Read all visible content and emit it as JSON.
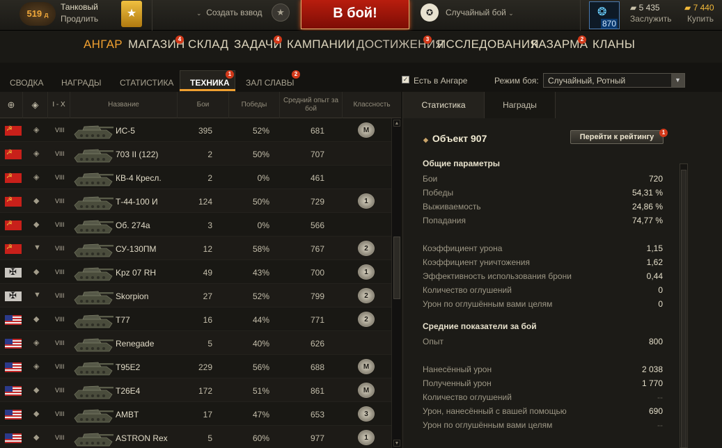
{
  "topbar": {
    "premium_days": "519",
    "premium_days_unit": "д",
    "premium_title": "Танковый",
    "premium_extend": "Продлить",
    "create_platoon": "Создать взвод",
    "battle_button": "В бой!",
    "battle_mode": "Случайный бой",
    "gold_box_count": "870",
    "credits": "5 435",
    "earn_label": "Заслужить",
    "gold": "7 440",
    "buy_label": "Купить"
  },
  "main_nav": [
    {
      "label": "АНГАР",
      "badge": ""
    },
    {
      "label": "МАГАЗИН",
      "badge": "4"
    },
    {
      "label": "СКЛАД",
      "badge": ""
    },
    {
      "label": "ЗАДАЧИ",
      "badge": "4"
    },
    {
      "label": "КАМПАНИИ",
      "badge": ""
    },
    {
      "label": "ДОСТИЖЕНИЯ",
      "badge": "3"
    },
    {
      "label": "ИССЛЕДОВАНИЯ",
      "badge": ""
    },
    {
      "label": "КАЗАРМА",
      "badge": "2"
    },
    {
      "label": "КЛАНЫ",
      "badge": ""
    }
  ],
  "sub_tabs": [
    {
      "label": "СВОДКА",
      "badge": ""
    },
    {
      "label": "НАГРАДЫ",
      "badge": ""
    },
    {
      "label": "СТАТИСТИКА",
      "badge": ""
    },
    {
      "label": "ТЕХНИКА",
      "badge": "1"
    },
    {
      "label": "ЗАЛ СЛАВЫ",
      "badge": "2"
    }
  ],
  "filters": {
    "in_hangar_label": "Есть в Ангаре",
    "in_hangar_checked": true,
    "battle_mode_label": "Режим боя:",
    "battle_mode_value": "Случайный, Ротный"
  },
  "table": {
    "headers": {
      "nation": "globe-icon",
      "type": "vehicle-type-icon",
      "tier": "I - X",
      "name": "Название",
      "battles": "Бои",
      "wins": "Победы",
      "avg_exp": "Средний опыт за бой",
      "mastery": "Классность"
    },
    "rows": [
      {
        "nation": "ussr",
        "type": "◈",
        "tier": "VIII",
        "name": "ИС-5",
        "battles": "395",
        "wins": "52%",
        "exp": "681",
        "mastery": "M"
      },
      {
        "nation": "ussr",
        "type": "◈",
        "tier": "VIII",
        "name": "703 II (122)",
        "battles": "2",
        "wins": "50%",
        "exp": "707",
        "mastery": ""
      },
      {
        "nation": "ussr",
        "type": "◈",
        "tier": "VIII",
        "name": "КВ-4 Кресл.",
        "battles": "2",
        "wins": "0%",
        "exp": "461",
        "mastery": ""
      },
      {
        "nation": "ussr",
        "type": "◆",
        "tier": "VIII",
        "name": "Т-44-100 И",
        "battles": "124",
        "wins": "50%",
        "exp": "729",
        "mastery": "1"
      },
      {
        "nation": "ussr",
        "type": "◆",
        "tier": "VIII",
        "name": "Об. 274а",
        "battles": "3",
        "wins": "0%",
        "exp": "566",
        "mastery": ""
      },
      {
        "nation": "ussr",
        "type": "▼",
        "tier": "VIII",
        "name": "СУ-130ПМ",
        "battles": "12",
        "wins": "58%",
        "exp": "767",
        "mastery": "2"
      },
      {
        "nation": "ger",
        "type": "◆",
        "tier": "VIII",
        "name": "Kpz 07 RH",
        "battles": "49",
        "wins": "43%",
        "exp": "700",
        "mastery": "1"
      },
      {
        "nation": "ger",
        "type": "▼",
        "tier": "VIII",
        "name": "Skorpion",
        "battles": "27",
        "wins": "52%",
        "exp": "799",
        "mastery": "2"
      },
      {
        "nation": "usa",
        "type": "◆",
        "tier": "VIII",
        "name": "T77",
        "battles": "16",
        "wins": "44%",
        "exp": "771",
        "mastery": "2"
      },
      {
        "nation": "usa",
        "type": "◈",
        "tier": "VIII",
        "name": "Renegade",
        "battles": "5",
        "wins": "40%",
        "exp": "626",
        "mastery": ""
      },
      {
        "nation": "usa",
        "type": "◈",
        "tier": "VIII",
        "name": "T95E2",
        "battles": "229",
        "wins": "56%",
        "exp": "688",
        "mastery": "M"
      },
      {
        "nation": "usa",
        "type": "◆",
        "tier": "VIII",
        "name": "T26E4",
        "battles": "172",
        "wins": "51%",
        "exp": "861",
        "mastery": "M"
      },
      {
        "nation": "usa",
        "type": "◆",
        "tier": "VIII",
        "name": "AMBT",
        "battles": "17",
        "wins": "47%",
        "exp": "653",
        "mastery": "3"
      },
      {
        "nation": "usa",
        "type": "◆",
        "tier": "VIII",
        "name": "ASTRON Rex",
        "battles": "5",
        "wins": "60%",
        "exp": "977",
        "mastery": "1"
      }
    ]
  },
  "details": {
    "tabs": [
      "Статистика",
      "Награды"
    ],
    "vehicle_name": "Объект 907",
    "rating_button": "Перейти к рейтингу",
    "rating_badge": "1",
    "general_title": "Общие параметры",
    "general": [
      {
        "label": "Бои",
        "value": "720"
      },
      {
        "label": "Победы",
        "value": "54,31 %"
      },
      {
        "label": "Выживаемость",
        "value": "24,86 %"
      },
      {
        "label": "Попадания",
        "value": "74,77 %"
      },
      {
        "label": "Коэффициент урона",
        "value": "1,15"
      },
      {
        "label": "Коэффициент уничтожения",
        "value": "1,62"
      },
      {
        "label": "Эффективность использования брони",
        "value": "0,44"
      },
      {
        "label": "Количество оглушений",
        "value": "0"
      },
      {
        "label": "Урон по оглушённым вами целям",
        "value": "0"
      }
    ],
    "avg_title": "Средние показатели за бой",
    "avg": [
      {
        "label": "Опыт",
        "value": "800"
      },
      {
        "label": "Нанесённый урон",
        "value": "2 038"
      },
      {
        "label": "Полученный урон",
        "value": "1 770"
      },
      {
        "label": "Количество оглушений",
        "value": "--"
      },
      {
        "label": "Урон, нанесённый с вашей помощью",
        "value": "690"
      },
      {
        "label": "Урон по оглушённым вами целям",
        "value": "--"
      }
    ]
  },
  "colors": {
    "accent": "#f0a030",
    "battle_red": "#b81d0e",
    "badge": "#d2391a"
  }
}
